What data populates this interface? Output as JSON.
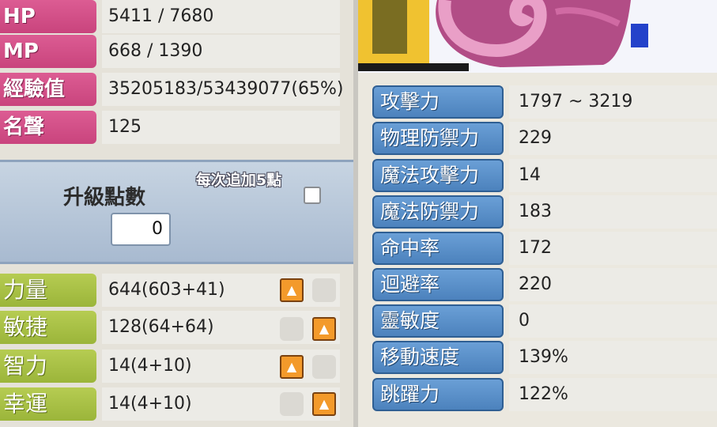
{
  "base_stats": [
    {
      "label": "HP",
      "value": "5411 / 7680"
    },
    {
      "label": "MP",
      "value": "668 / 1390"
    },
    {
      "label": "經驗值",
      "value": "35205183/53439077(65%)"
    },
    {
      "label": "名聲",
      "value": "125"
    }
  ],
  "ability_points": {
    "title": "升級點數",
    "value": "0",
    "auto_add_label": "每次追加5點",
    "auto_add_checked": false
  },
  "primary_stats": [
    {
      "label": "力量",
      "value": "644(603+41)"
    },
    {
      "label": "敏捷",
      "value": "128(64+64)"
    },
    {
      "label": "智力",
      "value": "14(4+10)"
    },
    {
      "label": "幸運",
      "value": "14(4+10)"
    }
  ],
  "detail_stats": [
    {
      "label": "攻擊力",
      "value": "1797 ~ 3219"
    },
    {
      "label": "物理防禦力",
      "value": "229"
    },
    {
      "label": "魔法攻擊力",
      "value": "14"
    },
    {
      "label": "魔法防禦力",
      "value": "183"
    },
    {
      "label": "命中率",
      "value": "172"
    },
    {
      "label": "迴避率",
      "value": "220"
    },
    {
      "label": "靈敏度",
      "value": "0"
    },
    {
      "label": "移動速度",
      "value": "139%"
    },
    {
      "label": "跳躍力",
      "value": "122%"
    }
  ],
  "colors": {
    "pink_label": "#d4528a",
    "green_label": "#a9c146",
    "blue_label": "#5b90c9",
    "up_button": "#f39a2b"
  },
  "icons": {
    "up_button": "arrow-up-icon"
  }
}
